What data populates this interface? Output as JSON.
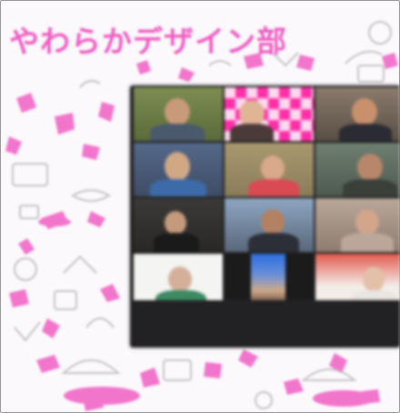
{
  "title": "やわらかデザイン部",
  "participants": [
    "",
    "",
    "",
    "",
    "",
    "",
    "",
    "",
    "",
    "",
    "",
    ""
  ],
  "name_labels": [
    "",
    ""
  ],
  "colors": {
    "title_pink": "#f05ec4",
    "background": "#fbf9fb",
    "window_bg": "#1f1f20"
  }
}
